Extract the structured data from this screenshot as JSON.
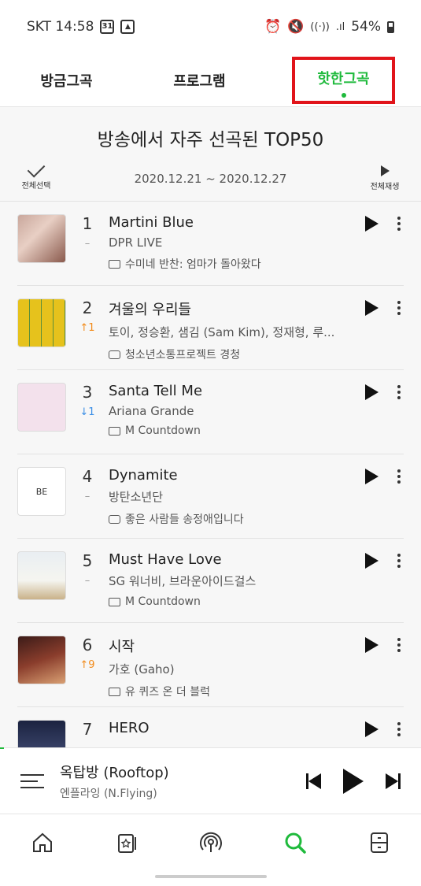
{
  "status": {
    "carrier_time": "SKT 14:58",
    "calendar_badge": "31",
    "battery": "54%"
  },
  "tabs": [
    {
      "label": "방금그곡"
    },
    {
      "label": "프로그램"
    },
    {
      "label": "핫한그곡"
    }
  ],
  "heading": "방송에서 자주 선곡된 TOP50",
  "controls": {
    "select_all": "전체선택",
    "date_range": "2020.12.21 ~ 2020.12.27",
    "play_all": "전체재생"
  },
  "songs": [
    {
      "rank": "1",
      "change": "–",
      "title": "Martini Blue",
      "artist": "DPR LIVE",
      "program": "수미네 반찬: 엄마가 돌아왔다"
    },
    {
      "rank": "2",
      "change": "↑1",
      "title": "겨울의 우리들",
      "artist": "토이, 정승환, 샘김 (Sam Kim), 정재형, 루...",
      "program": "청소년소통프로젝트 경청"
    },
    {
      "rank": "3",
      "change": "↓1",
      "title": "Santa Tell Me",
      "artist": "Ariana Grande",
      "program": "M Countdown"
    },
    {
      "rank": "4",
      "change": "–",
      "title": "Dynamite",
      "artist": "방탄소년단",
      "program": "좋은 사람들 송정애입니다"
    },
    {
      "rank": "5",
      "change": "–",
      "title": "Must Have Love",
      "artist": "SG 워너비, 브라운아이드걸스",
      "program": "M Countdown"
    },
    {
      "rank": "6",
      "change": "↑9",
      "title": "시작",
      "artist": "가호 (Gaho)",
      "program": "유 퀴즈 온 더 블럭"
    },
    {
      "rank": "7",
      "change": "",
      "title": "HERO",
      "artist": "",
      "program": ""
    }
  ],
  "album_art": {
    "art2_text": "",
    "art4_text": "BE"
  },
  "player": {
    "title": "옥탑방 (Rooftop)",
    "artist": "엔플라잉 (N.Flying)",
    "progress": 0.01
  },
  "colors": {
    "accent": "#1fba3c",
    "highlight": "#e1141a",
    "up": "#f28b1a",
    "down": "#3a8ee6"
  },
  "nav": [
    "home-icon",
    "star-card-icon",
    "broadcast-icon",
    "search-icon",
    "drawer-icon"
  ]
}
